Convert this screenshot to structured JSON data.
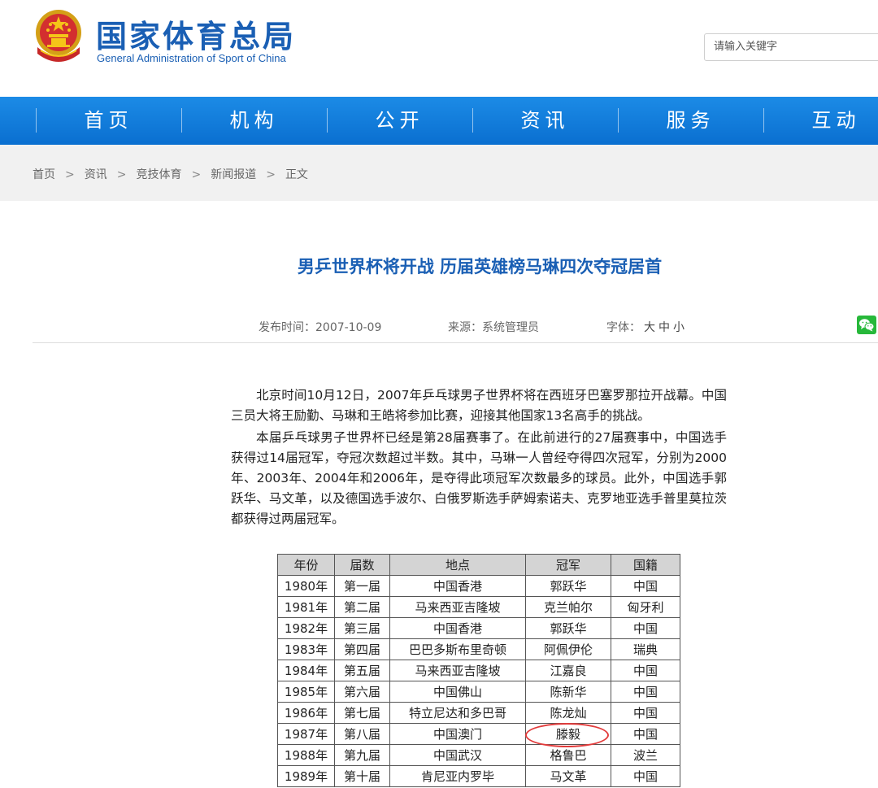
{
  "header": {
    "site_title": "国家体育总局",
    "site_subtitle": "General Administration of Sport of China",
    "search_placeholder": "请输入关键字"
  },
  "nav": {
    "items": [
      "首页",
      "机构",
      "公开",
      "资讯",
      "服务",
      "互动"
    ]
  },
  "breadcrumb": [
    "首页",
    "资讯",
    "竞技体育",
    "新闻报道",
    "正文"
  ],
  "breadcrumb_separator": ">",
  "article": {
    "title": "男乒世界杯将开战 历届英雄榜马琳四次夺冠居首",
    "publish_label": "发布时间：",
    "publish_date": "2007-10-09",
    "source_label": "来源：",
    "source": "系统管理员",
    "font_label": "字体：",
    "font_options": [
      "大",
      "中",
      "小"
    ],
    "paragraphs": [
      "北京时间10月12日，2007年乒乓球男子世界杯将在西班牙巴塞罗那拉开战幕。中国三员大将王励勤、马琳和王皓将参加比赛，迎接其他国家13名高手的挑战。",
      "本届乒乓球男子世界杯已经是第28届赛事了。在此前进行的27届赛事中，中国选手获得过14届冠军，夺冠次数超过半数。其中，马琳一人曾经夺得四次冠军，分别为2000年、2003年、2004年和2006年，是夺得此项冠军次数最多的球员。此外，中国选手郭跃华、马文革，以及德国选手波尔、白俄罗斯选手萨姆索诺夫、克罗地亚选手普里莫拉茨都获得过两届冠军。"
    ]
  },
  "table": {
    "headers": [
      "年份",
      "届数",
      "地点",
      "冠军",
      "国籍"
    ],
    "rows": [
      [
        "1980年",
        "第一届",
        "中国香港",
        "郭跃华",
        "中国"
      ],
      [
        "1981年",
        "第二届",
        "马来西亚吉隆坡",
        "克兰帕尔",
        "匈牙利"
      ],
      [
        "1982年",
        "第三届",
        "中国香港",
        "郭跃华",
        "中国"
      ],
      [
        "1983年",
        "第四届",
        "巴巴多斯布里奇顿",
        "阿佩伊伦",
        "瑞典"
      ],
      [
        "1984年",
        "第五届",
        "马来西亚吉隆坡",
        "江嘉良",
        "中国"
      ],
      [
        "1985年",
        "第六届",
        "中国佛山",
        "陈新华",
        "中国"
      ],
      [
        "1986年",
        "第七届",
        "特立尼达和多巴哥",
        "陈龙灿",
        "中国"
      ],
      [
        "1987年",
        "第八届",
        "中国澳门",
        "滕毅",
        "中国"
      ],
      [
        "1988年",
        "第九届",
        "中国武汉",
        "格鲁巴",
        "波兰"
      ],
      [
        "1989年",
        "第十届",
        "肯尼亚内罗毕",
        "马文革",
        "中国"
      ]
    ]
  },
  "colors": {
    "brand_blue": "#1a5fb4",
    "nav_blue": "#0a6fd0",
    "highlight_circle": "#e23c3c"
  }
}
